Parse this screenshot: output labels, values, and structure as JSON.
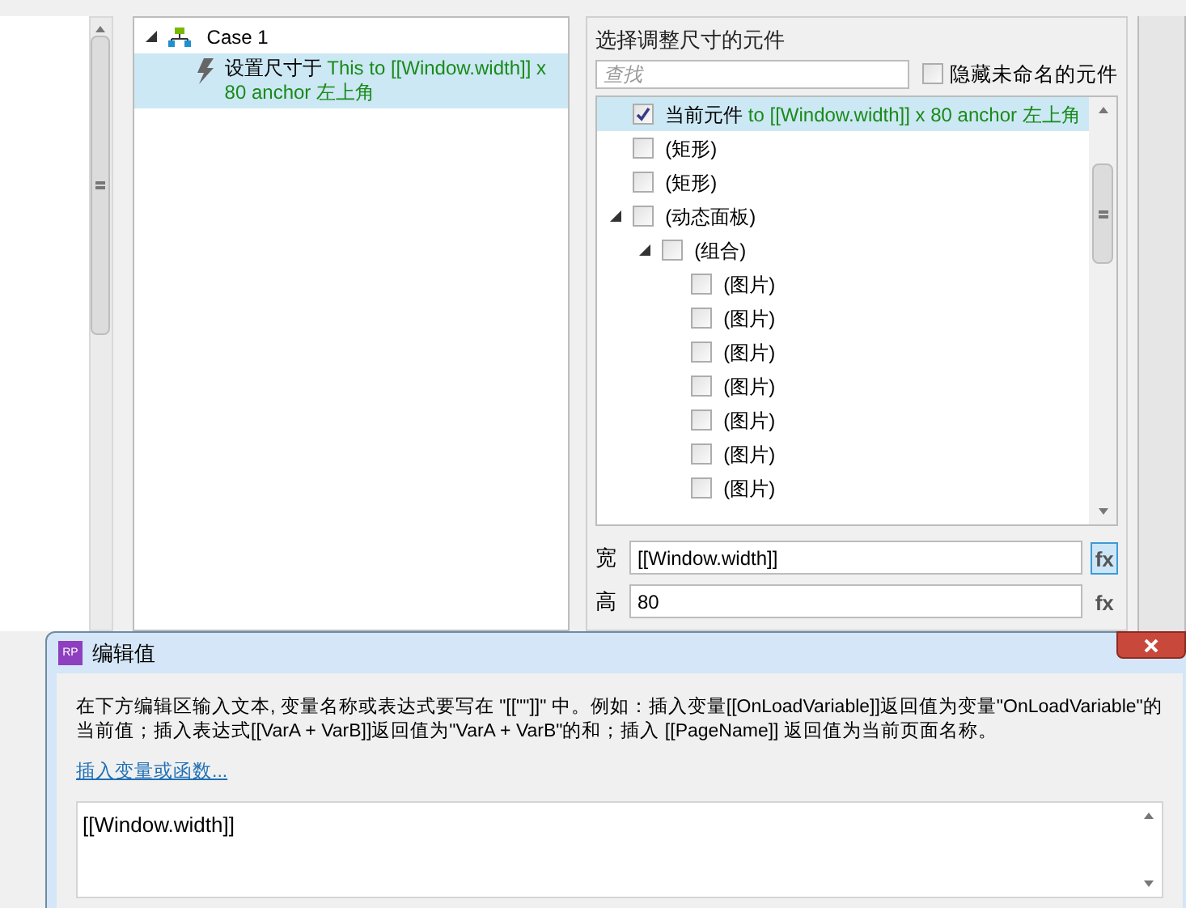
{
  "case_panel": {
    "case": {
      "label": "Case 1",
      "expanded": true
    },
    "actions": [
      {
        "verb": "设置尺寸于",
        "detail": "This to [[Window.width]] x 80 anchor 左上角",
        "selected": true
      }
    ]
  },
  "widget_panel": {
    "title": "选择调整尺寸的元件",
    "search": {
      "placeholder": "查找"
    },
    "hide_unnamed": {
      "label": "隐藏未命名的元件",
      "checked": false
    },
    "tree": [
      {
        "label": "当前元件",
        "detail": "to [[Window.width]] x 80 anchor 左上角",
        "checked": true,
        "selected": true
      },
      {
        "label": "(矩形)",
        "checked": false,
        "selected": false
      },
      {
        "label": "(矩形)",
        "checked": false,
        "selected": false
      },
      {
        "label": "(动态面板)",
        "checked": false,
        "selected": false,
        "expanded": true,
        "children": [
          {
            "label": "(组合)",
            "checked": false,
            "selected": false,
            "expanded": true,
            "children": [
              {
                "label": "(图片)",
                "checked": false,
                "selected": false
              },
              {
                "label": "(图片)",
                "checked": false,
                "selected": false
              },
              {
                "label": "(图片)",
                "checked": false,
                "selected": false
              },
              {
                "label": "(图片)",
                "checked": false,
                "selected": false
              },
              {
                "label": "(图片)",
                "checked": false,
                "selected": false
              },
              {
                "label": "(图片)",
                "checked": false,
                "selected": false
              },
              {
                "label": "(图片)",
                "checked": false,
                "selected": false
              }
            ]
          }
        ]
      }
    ],
    "size_fields": [
      {
        "label": "宽",
        "value": "[[Window.width]]",
        "fx": "fx",
        "selected": true
      },
      {
        "label": "高",
        "value": "80",
        "fx": "fx",
        "selected": false
      }
    ]
  },
  "dialog": {
    "title": "编辑值",
    "app_icon": "RP",
    "instructions": "在下方编辑区输入文本, 变量名称或表达式要写在 \"[[\"\"]]\" 中。例如：插入变量[[OnLoadVariable]]返回值为变量\"OnLoadVariable\"的当前值；插入表达式[[VarA + VarB]]返回值为\"VarA + VarB\"的和；插入 [[PageName]] 返回值为当前页面名称。",
    "link": "插入变量或函数...",
    "value": "[[Window.width]]"
  }
}
